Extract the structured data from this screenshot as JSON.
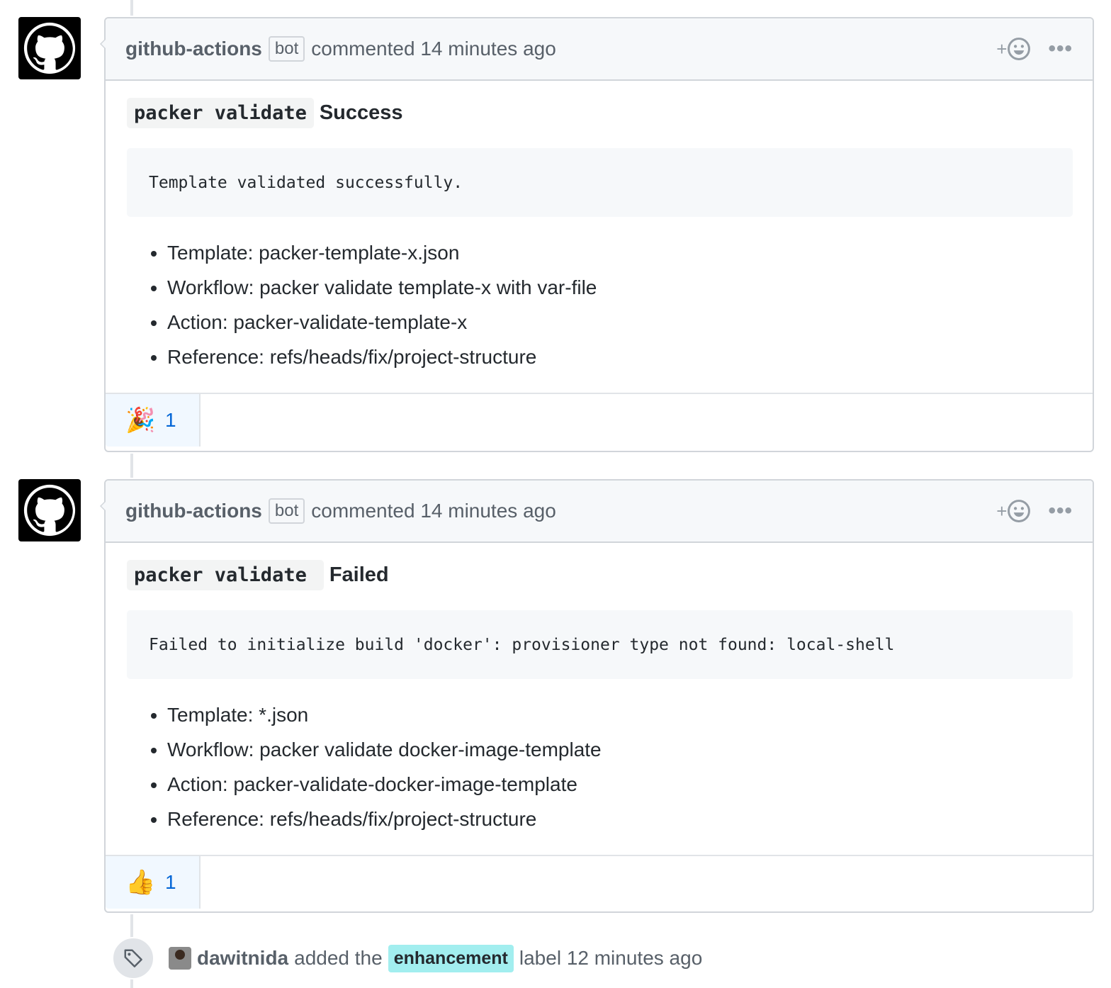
{
  "comments": [
    {
      "author": "github-actions",
      "badge": "bot",
      "meta": "commented 14 minutes ago",
      "command": "packer validate",
      "status": "Success",
      "output": "Template validated successfully.",
      "items": [
        "Template: packer-template-x.json",
        "Workflow: packer validate template-x with var-file",
        "Action: packer-validate-template-x",
        "Reference: refs/heads/fix/project-structure"
      ],
      "reaction": {
        "icon": "tada-icon",
        "emoji": "🎉",
        "count": "1"
      }
    },
    {
      "author": "github-actions",
      "badge": "bot",
      "meta": "commented 14 minutes ago",
      "command": "packer validate",
      "status": "Failed",
      "output": "Failed to initialize build 'docker': provisioner type not found: local-shell",
      "items": [
        "Template: *.json",
        "Workflow: packer validate docker-image-template",
        "Action: packer-validate-docker-image-template",
        "Reference: refs/heads/fix/project-structure"
      ],
      "reaction": {
        "icon": "thumbsup-icon",
        "emoji": "👍",
        "count": "1"
      }
    }
  ],
  "header_actions": {
    "add_reaction": "+",
    "more": "•••"
  },
  "event": {
    "actor": "dawitnida",
    "verb": "added the",
    "label": "enhancement",
    "suffix": "label 12 minutes ago",
    "label_color": "#a2eeef"
  },
  "colors": {
    "link_blue": "#0366d6",
    "border": "#d1d5da",
    "header_bg": "#f6f8fa",
    "text": "#24292e",
    "muted": "#586069"
  }
}
